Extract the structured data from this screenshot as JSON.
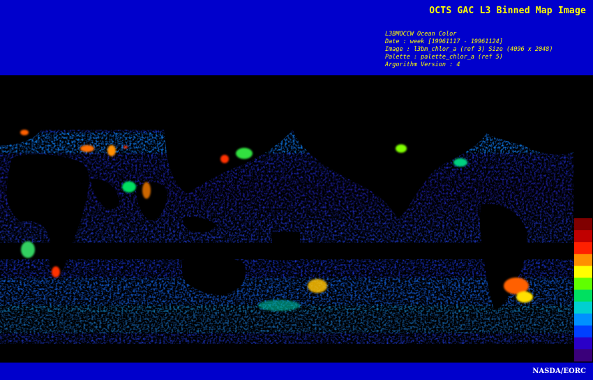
{
  "header": {
    "title": "OCTS GAC L3 Binned Map Image",
    "meta_lines": [
      "L3BMOCCW Ocean Color",
      "Date : week [19961117 - 19961124]",
      "Image : l3bm_chlor_a (ref 3) Size (4096 x 2048)",
      "Palette : palette_chlor_a (ref 5)",
      "Argorithm Version : 4"
    ]
  },
  "footer": {
    "credit": "NASDA/EORC"
  },
  "colors": {
    "header_bg": "#0000cc",
    "text_yellow": "#ffff00",
    "text_white": "#ffffff",
    "land": "#000000",
    "palette": [
      "#3a007a",
      "#2a00c8",
      "#0040ff",
      "#0090ff",
      "#00d0d0",
      "#00e060",
      "#60ff00",
      "#ffff00",
      "#ff9000",
      "#ff2000",
      "#c00000",
      "#800000"
    ]
  },
  "map": {
    "description_icon": "world-chlorophyll-map"
  }
}
